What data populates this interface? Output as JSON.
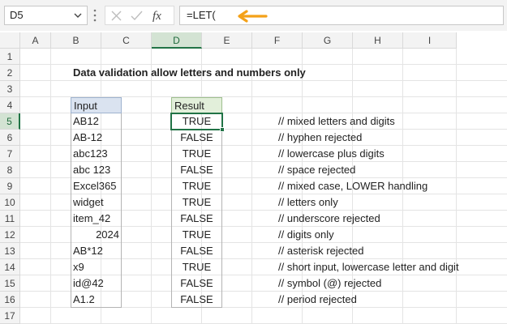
{
  "name_box": "D5",
  "formula": "=LET(",
  "icons": {
    "cancel": "x-icon",
    "enter": "check-icon",
    "function": "fx-icon",
    "pointer": "arrow-icon",
    "accent": "#f4a118"
  },
  "columns": [
    "A",
    "B",
    "C",
    "D",
    "E",
    "F",
    "G",
    "H",
    "I"
  ],
  "rows": [
    "1",
    "2",
    "3",
    "4",
    "5",
    "6",
    "7",
    "8",
    "9",
    "10",
    "11",
    "12",
    "13",
    "14",
    "15",
    "16",
    "17"
  ],
  "active_cell": {
    "column": "D",
    "row": "5"
  },
  "title": "Data validation allow letters and numbers only",
  "headers": {
    "input": "Input",
    "result": "Result"
  },
  "table": [
    {
      "input": "AB12",
      "result": "TRUE",
      "comment": "//  mixed letters and digits"
    },
    {
      "input": "AB-12",
      "result": "FALSE",
      "comment": "//  hyphen rejected"
    },
    {
      "input": "abc123",
      "result": "TRUE",
      "comment": "//  lowercase plus digits"
    },
    {
      "input": "abc 123",
      "result": "FALSE",
      "comment": "//  space rejected"
    },
    {
      "input": "Excel365",
      "result": "TRUE",
      "comment": "//  mixed case, LOWER handling"
    },
    {
      "input": "widget",
      "result": "TRUE",
      "comment": "//  letters only"
    },
    {
      "input": "item_42",
      "result": "FALSE",
      "comment": "//  underscore rejected"
    },
    {
      "input": "2024",
      "result": "TRUE",
      "comment": "//  digits only"
    },
    {
      "input": "AB*12",
      "result": "FALSE",
      "comment": "//  asterisk rejected"
    },
    {
      "input": "x9",
      "result": "TRUE",
      "comment": "//  short input, lowercase letter and digit"
    },
    {
      "input": "id@42",
      "result": "FALSE",
      "comment": "//  symbol (@) rejected"
    },
    {
      "input": "A1.2",
      "result": "FALSE",
      "comment": "//  period rejected"
    }
  ]
}
